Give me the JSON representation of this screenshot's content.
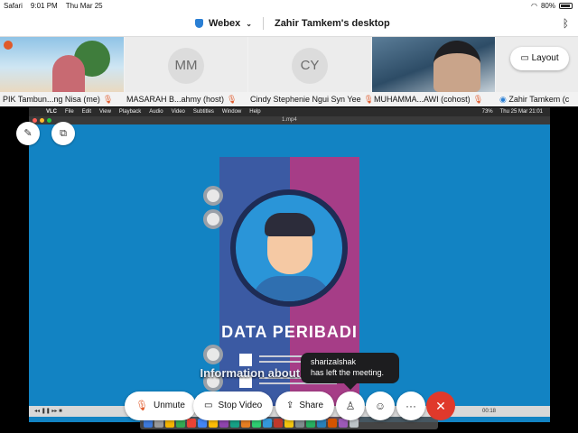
{
  "status_bar": {
    "app_back": "Safari",
    "time": "9:01 PM",
    "date": "Thu Mar 25",
    "battery": "80%"
  },
  "header": {
    "app_name": "Webex",
    "shared_title": "Zahir Tamkem's desktop"
  },
  "participants": [
    {
      "name": "PIK Tambun...ng Nisa (me)",
      "initials": "",
      "muted": true
    },
    {
      "name": "MASARAH B...ahmy (host)",
      "initials": "MM",
      "muted": true
    },
    {
      "name": "Cindy Stephenie Ngui Syn Yee",
      "initials": "CY",
      "muted": true
    },
    {
      "name": "MUHAMMA...AWI (cohost)",
      "initials": "",
      "muted": true
    },
    {
      "name": "Zahir Tamkem (c",
      "initials": "",
      "muted": false
    }
  ],
  "layout_button": "Layout",
  "mac_menu": {
    "items": [
      "VLC",
      "File",
      "Edit",
      "View",
      "Playback",
      "Audio",
      "Video",
      "Subtitles",
      "Window",
      "Help"
    ],
    "clock": "Thu 25 Mar  21:01",
    "battery": "73%"
  },
  "vlc": {
    "filename": "1.mp4",
    "elapsed": "00:18"
  },
  "video": {
    "title": "DATA PERIBADI",
    "subtitle": "Information about you is ki                Data"
  },
  "toast": {
    "user": "sharizalshak",
    "message": "has left the meeting."
  },
  "controls": {
    "unmute": "Unmute",
    "stop_video": "Stop Video",
    "share": "Share",
    "more": "···"
  },
  "colors": {
    "accent_blue": "#1283c3",
    "end_red": "#e0392b",
    "mute_orange": "#e0592a"
  }
}
